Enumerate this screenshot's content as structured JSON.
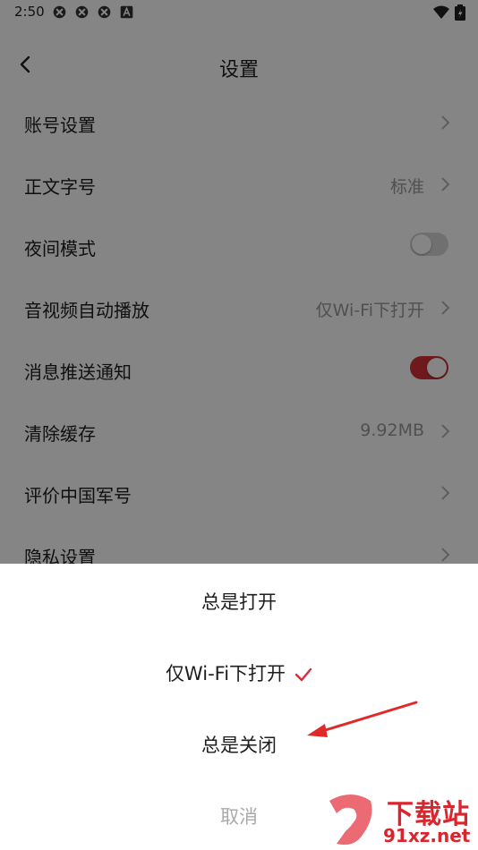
{
  "status_bar": {
    "time": "2:50",
    "notification_icons": [
      "app-icon",
      "app-icon",
      "app-icon",
      "text-a-icon"
    ],
    "right_icons": [
      "wifi-icon",
      "battery-icon"
    ]
  },
  "header": {
    "title": "设置",
    "back_icon": "chevron-left-icon"
  },
  "settings": [
    {
      "label": "账号设置",
      "value": "",
      "type": "link"
    },
    {
      "label": "正文字号",
      "value": "标准",
      "type": "link"
    },
    {
      "label": "夜间模式",
      "value": "",
      "type": "toggle",
      "on": false
    },
    {
      "label": "音视频自动播放",
      "value": "仅Wi-Fi下打开",
      "type": "link"
    },
    {
      "label": "消息推送通知",
      "value": "",
      "type": "toggle",
      "on": true
    },
    {
      "label": "清除缓存",
      "value": "9.92MB",
      "type": "link"
    },
    {
      "label": "评价中国军号",
      "value": "",
      "type": "link"
    },
    {
      "label": "隐私设置",
      "value": "",
      "type": "link"
    }
  ],
  "sheet": {
    "options": [
      {
        "label": "总是打开",
        "selected": false
      },
      {
        "label": "仅Wi-Fi下打开",
        "selected": true
      },
      {
        "label": "总是关闭",
        "selected": false
      }
    ],
    "cancel": "取消"
  },
  "watermark": {
    "line1": "下载站",
    "line2": "91xz.net"
  },
  "colors": {
    "accent": "#d1303a",
    "toggle_off": "#d6d6d6",
    "annotation_arrow": "#e02a2a"
  }
}
